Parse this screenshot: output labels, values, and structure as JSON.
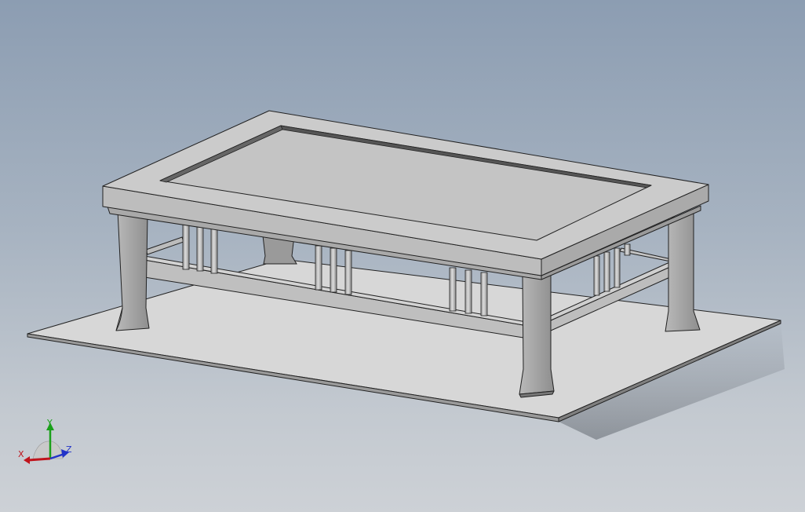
{
  "viewport": {
    "model": "table",
    "background_top": "#8c9db2",
    "background_bottom": "#cdd1d6",
    "edge_color": "#111111"
  },
  "triad": {
    "x_label": "X",
    "y_label": "Y",
    "z_label": "Z",
    "x_color": "#c0141c",
    "y_color": "#1aa01a",
    "z_color": "#2233c8"
  }
}
